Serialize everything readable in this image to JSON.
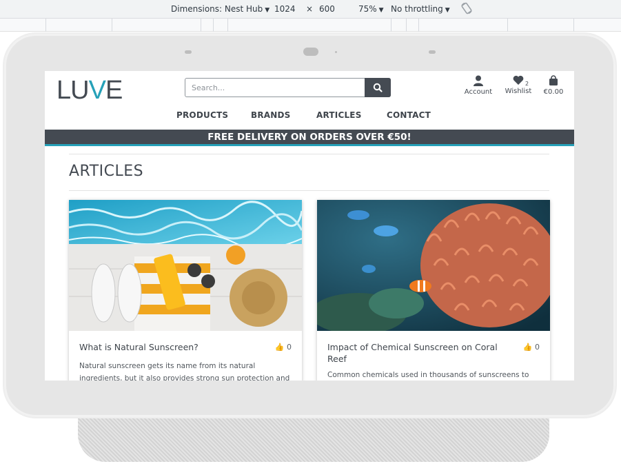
{
  "devtools": {
    "dimensions_label": "Dimensions: Nest Hub",
    "width": "1024",
    "times": "×",
    "height": "600",
    "zoom": "75%",
    "throttling": "No throttling"
  },
  "site": {
    "logo_main": "LU",
    "logo_accent": "V",
    "logo_end": "E",
    "search_placeholder": "Search...",
    "account_label": "Account",
    "wishlist_label": "Wishlist",
    "wishlist_count": "2",
    "bag_total": "€0.00",
    "nav": [
      "PRODUCTS",
      "BRANDS",
      "ARTICLES",
      "CONTACT"
    ],
    "banner": "FREE DELIVERY ON ORDERS OVER €50!",
    "page_title": "ARTICLES",
    "articles": [
      {
        "title": "What is Natural Sunscreen?",
        "likes": "0",
        "excerpt_line1": "Natural sunscreen gets its name from its natural",
        "excerpt_line2": "ingredients, but it also provides strong sun protection and"
      },
      {
        "title": "Impact of Chemical Sunscreen on Coral Reef",
        "likes": "0",
        "excerpt_line1": "Common chemicals used in thousands of sunscreens to"
      }
    ]
  },
  "colors": {
    "brand_dark": "#444a52",
    "brand_accent": "#26a1b8"
  }
}
